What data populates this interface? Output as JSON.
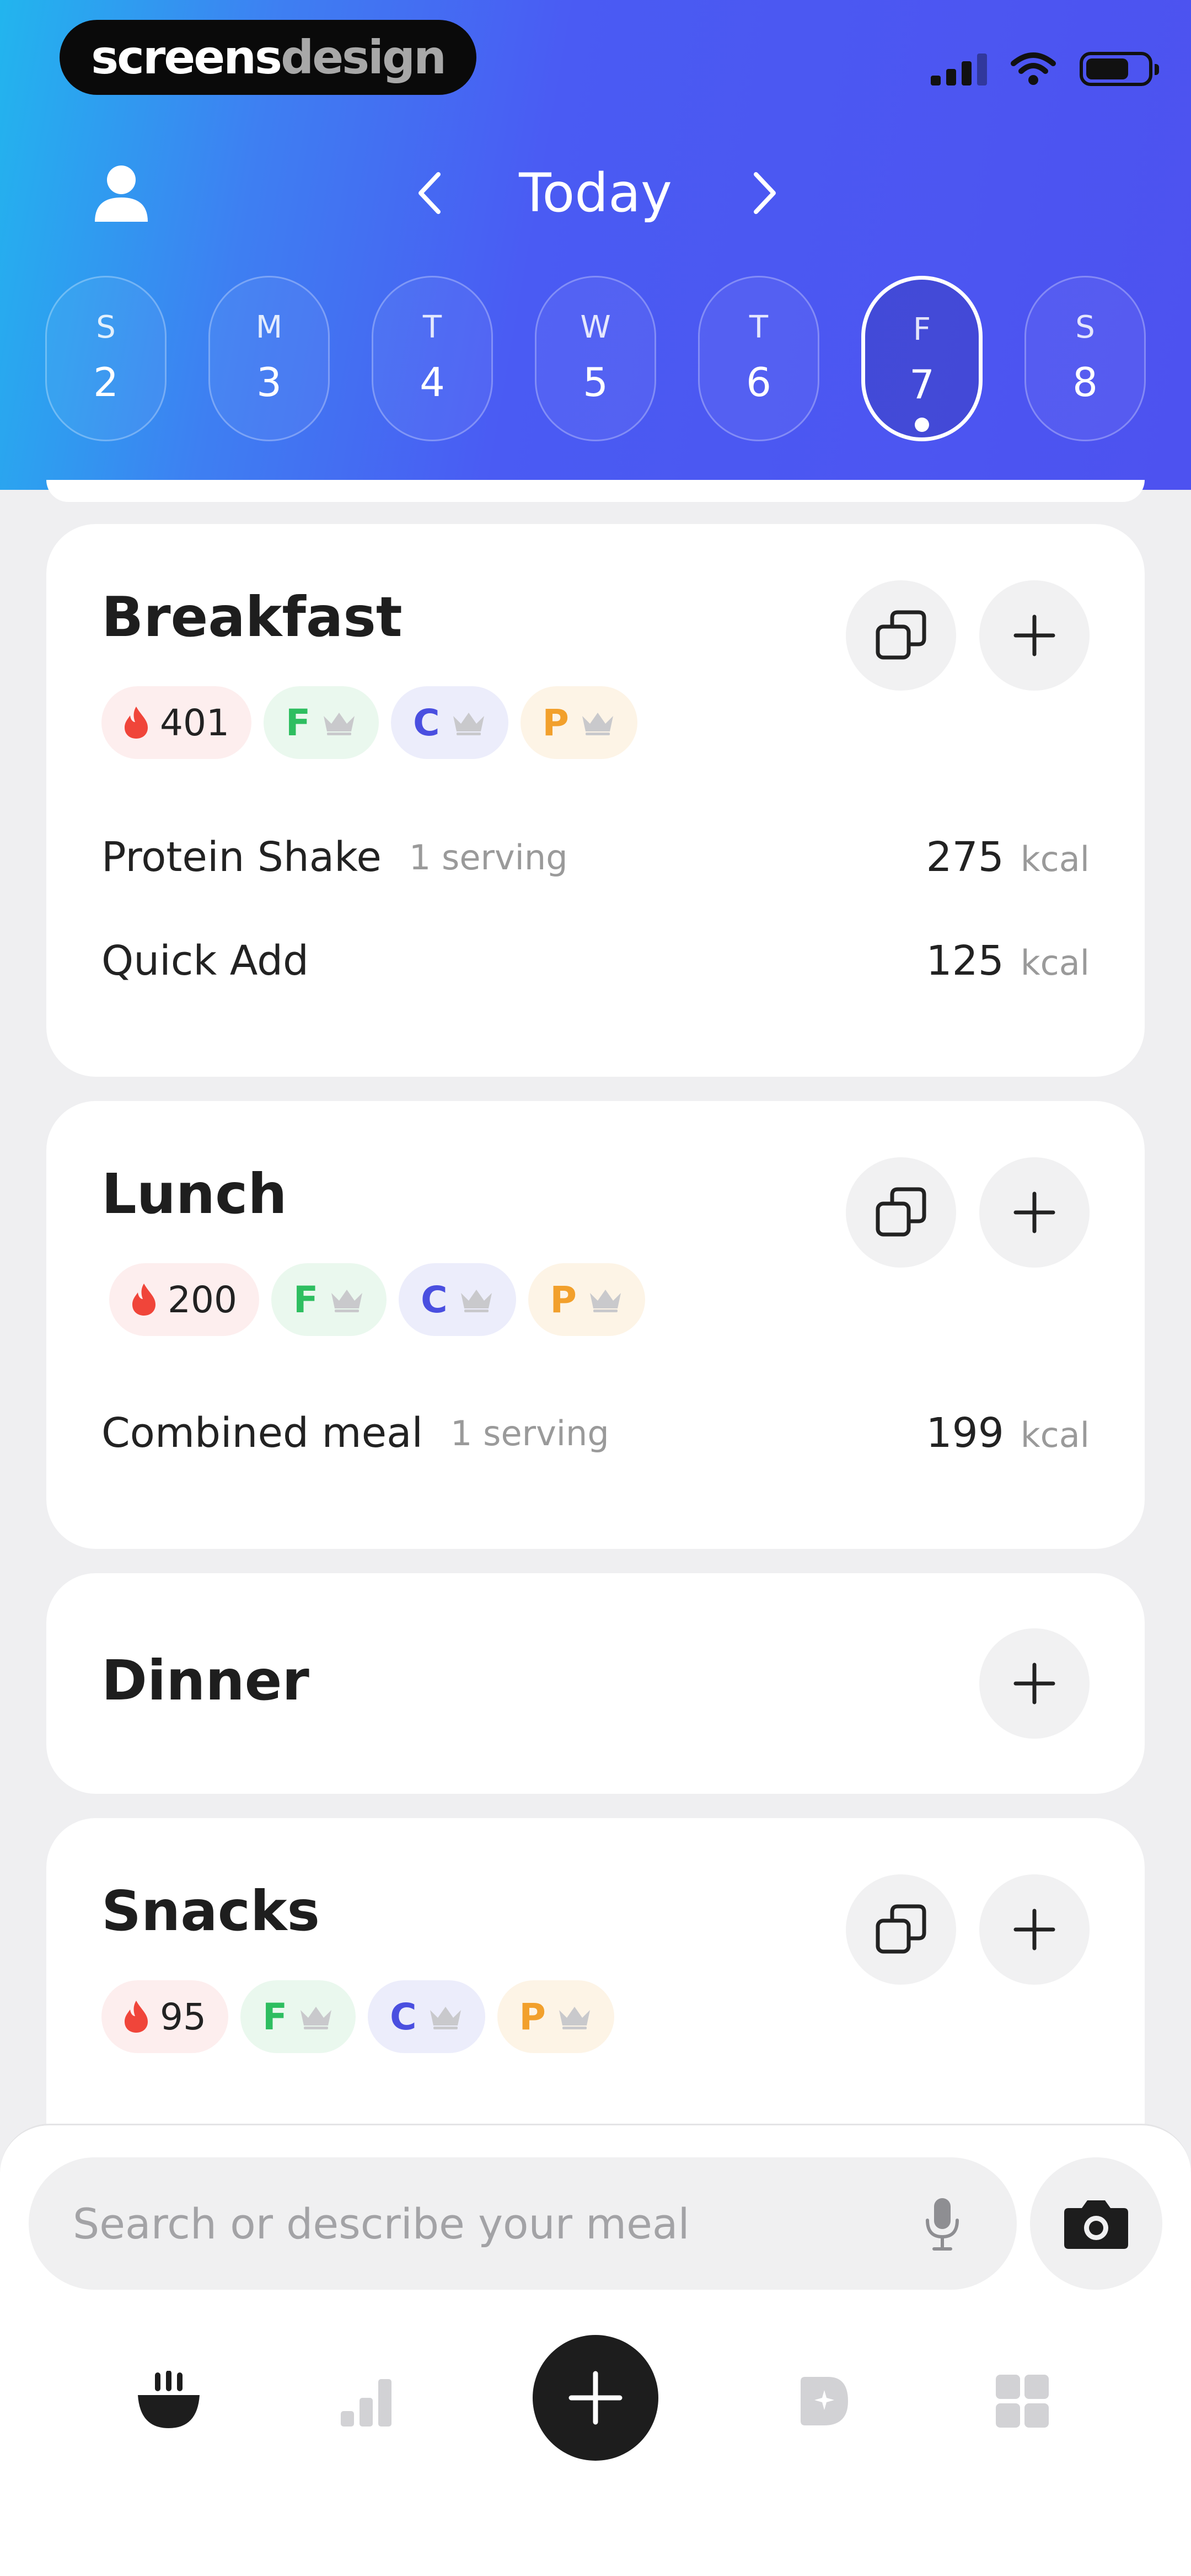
{
  "brand": {
    "part1": "screens",
    "part2": "design"
  },
  "header": {
    "title": "Today"
  },
  "days": [
    {
      "letter": "S",
      "number": "2"
    },
    {
      "letter": "M",
      "number": "3"
    },
    {
      "letter": "T",
      "number": "4"
    },
    {
      "letter": "W",
      "number": "5"
    },
    {
      "letter": "T",
      "number": "6"
    },
    {
      "letter": "F",
      "number": "7",
      "selected": true
    },
    {
      "letter": "S",
      "number": "8"
    }
  ],
  "macros": {
    "fat": "F",
    "carbs": "C",
    "protein": "P"
  },
  "meals": {
    "breakfast": {
      "title": "Breakfast",
      "calories": "401",
      "items": [
        {
          "name": "Protein Shake",
          "serving": "1 serving",
          "kcal": "275",
          "unit": "kcal"
        },
        {
          "name": "Quick Add",
          "serving": "",
          "kcal": "125",
          "unit": "kcal"
        }
      ]
    },
    "lunch": {
      "title": "Lunch",
      "calories": "200",
      "items": [
        {
          "name": "Combined meal",
          "serving": "1 serving",
          "kcal": "199",
          "unit": "kcal"
        }
      ]
    },
    "dinner": {
      "title": "Dinner"
    },
    "snacks": {
      "title": "Snacks",
      "calories": "95"
    }
  },
  "search": {
    "placeholder": "Search or describe your meal"
  },
  "colors": {
    "accent": "#4d52f0",
    "fat": "#2ebe60",
    "carbs": "#4a4fe0",
    "protein": "#f2a02c",
    "flame": "#f0453a"
  },
  "icons": {
    "profile": "user-icon",
    "prev": "chevron-left-icon",
    "next": "chevron-right-icon",
    "copy": "copy-icon",
    "add": "plus-icon",
    "flame": "flame-icon",
    "crown": "crown-icon",
    "mic": "microphone-icon",
    "camera": "camera-icon"
  }
}
